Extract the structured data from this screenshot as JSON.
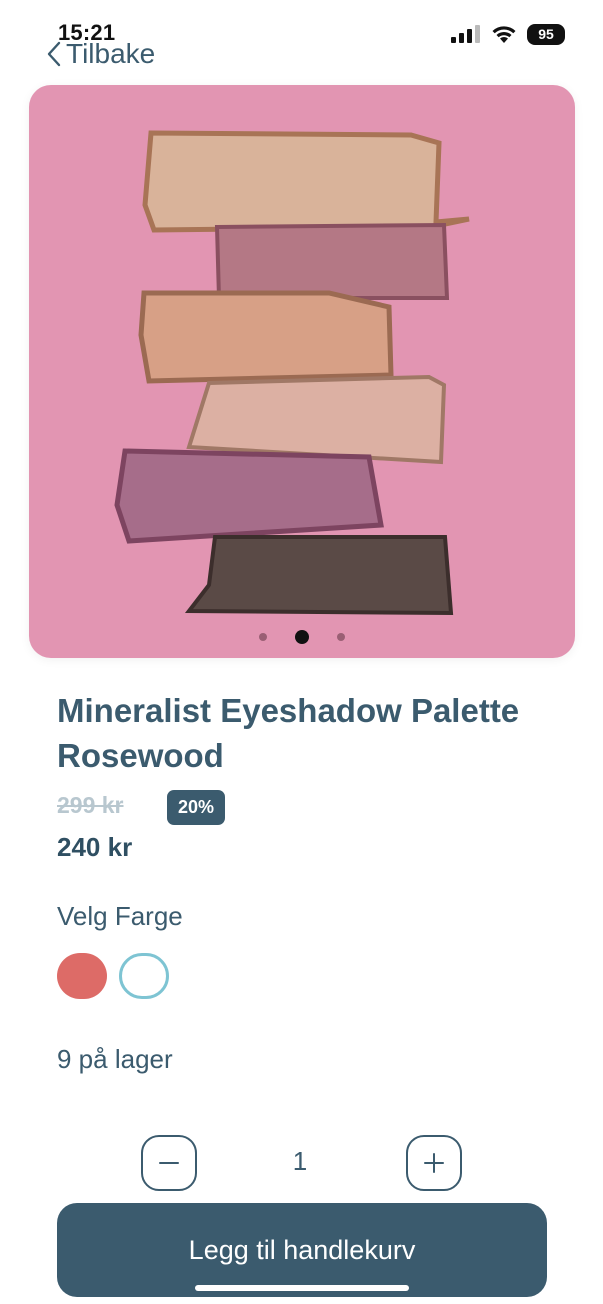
{
  "status_bar": {
    "time": "15:21",
    "battery": "95"
  },
  "nav": {
    "back_label": "Tilbake"
  },
  "gallery": {
    "dot_count": 3,
    "active_index": 1,
    "background": "#e295b2"
  },
  "product": {
    "name": "Mineralist Eyeshadow Palette Rosewood",
    "old_price": "299 kr",
    "discount": "20%",
    "price": "240 kr"
  },
  "color_picker": {
    "label": "Velg Farge",
    "swatches": [
      {
        "color": "#dd6b67",
        "selected": false
      },
      {
        "color": "#ffffff",
        "border": "#7ec4d3",
        "selected": true
      }
    ]
  },
  "stock": {
    "text": "9 på lager"
  },
  "quantity": {
    "value": "1",
    "minus_icon": "minus-icon",
    "plus_icon": "plus-icon"
  },
  "cart_button": {
    "label": "Legg til handlekurv"
  },
  "colors": {
    "primary": "#3b5b6e",
    "accent_swatch": "#dd6b67",
    "outline": "#7ec4d3"
  }
}
